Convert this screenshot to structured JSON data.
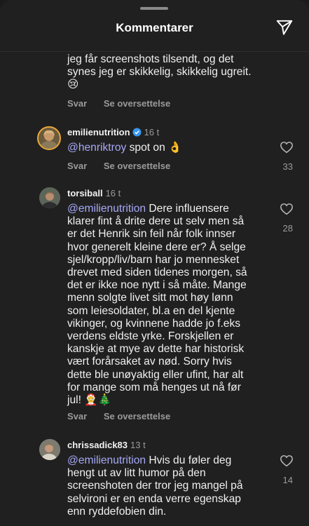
{
  "header": {
    "title": "Kommentarer",
    "share_icon": "send-icon"
  },
  "comments": [
    {
      "text_lines": [
        "jeg får screenshots tilsendt, og det",
        "synes jeg er skikkelig, skikkelig ugreit.",
        "😢"
      ],
      "reply_label": "Svar",
      "translate_label": "Se oversettelse"
    },
    {
      "username": "emilienutrition",
      "verified": true,
      "time": "16 t",
      "mention": "@henriktroy",
      "text": " spot on 👌",
      "likes": "33",
      "reply_label": "Svar",
      "translate_label": "Se oversettelse"
    },
    {
      "username": "torsiball",
      "time": "16 t",
      "mention": "@emilienutrition",
      "text_lines": [
        " Dere influensere",
        "klarer fint å drite dere ut selv men så",
        "er det Henrik sin feil når folk innser",
        "hvor generelt kleine dere er? Å selge",
        "sjel/kropp/liv/barn har jo mennesket",
        "drevet med siden tidenes morgen, så",
        "det er ikke noe nytt i så måte. Mange",
        "menn solgte livet sitt mot høy lønn",
        "som leiesoldater, bl.a en del kjente",
        "vikinger, og kvinnene hadde jo f.eks",
        "verdens eldste yrke. Forskjellen er",
        "kanskje at mye av dette har historisk",
        "vært forårsaket av nød. Sorry hvis",
        "dette ble unøyaktig eller ufint, har alt",
        "for mange som må henges ut nå før",
        "jul! 🤶🎄"
      ],
      "likes": "28",
      "reply_label": "Svar",
      "translate_label": "Se oversettelse"
    },
    {
      "username": "chrissadick83",
      "time": "13 t",
      "mention": "@emilienutrition",
      "text_lines": [
        " Hvis du føler deg",
        "hengt ut av litt humor på den",
        "screenshoten der tror jeg mangel på",
        "selvironi er en enda verre egenskap",
        "enn ryddefobien din."
      ],
      "likes": "14"
    }
  ]
}
